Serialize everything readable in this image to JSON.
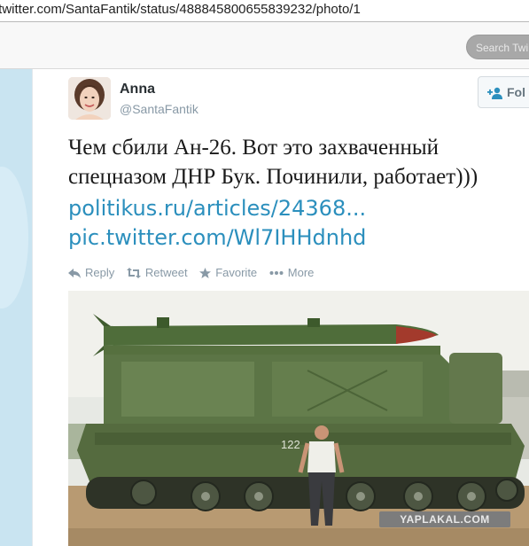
{
  "browser": {
    "url": "/twitter.com/SantaFantik/status/488845800655839232/photo/1"
  },
  "topbar": {
    "search_placeholder": "Search Twi"
  },
  "tweet": {
    "fullname": "Anna",
    "handle": "@SantaFantik",
    "follow_label": "Fol",
    "text_line1": "Чем сбили Ан-26. Вот это захваченный",
    "text_line2": "спецназом ДНР Бук. Починили, работает)))",
    "link1": "politikus.ru/articles/24368...",
    "link2": "pic.twitter.com/Wl7IHHdnhd",
    "actions": {
      "reply": "Reply",
      "retweet": "Retweet",
      "favorite": "Favorite",
      "more": "More"
    },
    "photo": {
      "vehicle_number": "122",
      "watermark": "YAPLAKAL.COM"
    }
  },
  "colors": {
    "link": "#2b8fbd",
    "muted": "#8899a6",
    "page_bg": "#c0deed"
  }
}
